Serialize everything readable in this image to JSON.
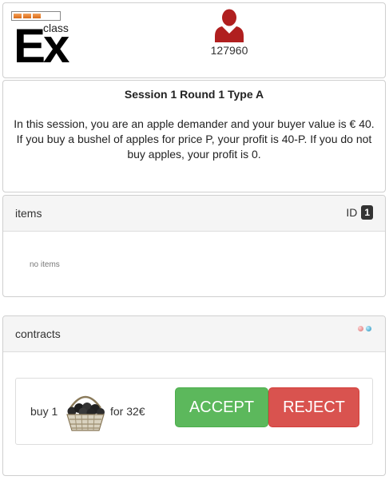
{
  "header": {
    "logo": {
      "text_main": "Ex",
      "text_small": "class",
      "progress_segments": 3
    },
    "user": {
      "icon": "user-icon",
      "id": "127960",
      "icon_color": "#b01f1f"
    }
  },
  "info": {
    "title": "Session 1 Round 1 Type A",
    "text_1": "In this session, you are an apple demander and your buyer value is € 40.",
    "text_2": "If you buy a bushel of apples for price P, your profit is 40-P. If you do not buy apples, your profit is 0."
  },
  "items": {
    "heading": "items",
    "id_label": "ID",
    "id_value": "1",
    "empty_text": "no items"
  },
  "contracts": {
    "heading": "contracts",
    "status_icons": [
      "red-dot-icon",
      "blue-dot-icon"
    ],
    "contract": {
      "prefix": "buy 1",
      "item_icon": "apple-basket-icon",
      "price_text": "for 32€",
      "accept_label": "ACCEPT",
      "reject_label": "REJECT"
    }
  },
  "colors": {
    "accept": "#5cb85c",
    "reject": "#d9534f",
    "heading_bg": "#f5f5f5",
    "border": "#cfcfcf"
  }
}
